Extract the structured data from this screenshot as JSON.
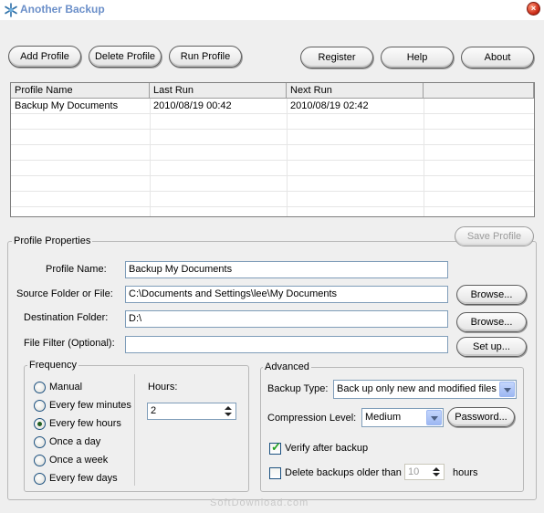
{
  "window": {
    "title": "Another Backup",
    "close_glyph": "×"
  },
  "toolbar": {
    "add_profile": "Add Profile",
    "delete_profile": "Delete Profile",
    "run_profile": "Run Profile",
    "register": "Register",
    "help": "Help",
    "about": "About"
  },
  "profiles_table": {
    "columns": [
      "Profile Name",
      "Last Run",
      "Next Run"
    ],
    "rows": [
      [
        "Backup My Documents",
        "2010/08/19 00:42",
        "2010/08/19 02:42"
      ]
    ]
  },
  "properties": {
    "group_title": "Profile Properties",
    "save_profile": "Save Profile",
    "profile_name_label": "Profile Name:",
    "profile_name_value": "Backup My Documents",
    "source_label": "Source Folder or File:",
    "source_value": "C:\\Documents and Settings\\lee\\My Documents",
    "browse_label": "Browse...",
    "destination_label": "Destination Folder:",
    "destination_value": "D:\\",
    "filter_label": "File Filter (Optional):",
    "filter_value": "",
    "setup_label": "Set up..."
  },
  "frequency": {
    "title": "Frequency",
    "options": [
      "Manual",
      "Every few minutes",
      "Every few hours",
      "Once a day",
      "Once a week",
      "Every few days"
    ],
    "selected": "Every few hours",
    "hours_label": "Hours:",
    "hours_value": "2"
  },
  "advanced": {
    "title": "Advanced",
    "backup_type_label": "Backup Type:",
    "backup_type_value": "Back up only new and modified files",
    "compression_label": "Compression Level:",
    "compression_value": "Medium",
    "password_button": "Password...",
    "verify_label": "Verify after backup",
    "verify_checked": true,
    "delete_older_label": "Delete backups older than",
    "delete_older_checked": false,
    "delete_older_value": "10",
    "hours_unit": "hours"
  },
  "watermark": "SoftDownload.com",
  "colors": {
    "title_text": "#6b8fc9",
    "window_bg": "#efefef",
    "field_border": "#7f9db9"
  },
  "icons": {
    "app": "snowflake-icon",
    "close": "close-icon"
  }
}
